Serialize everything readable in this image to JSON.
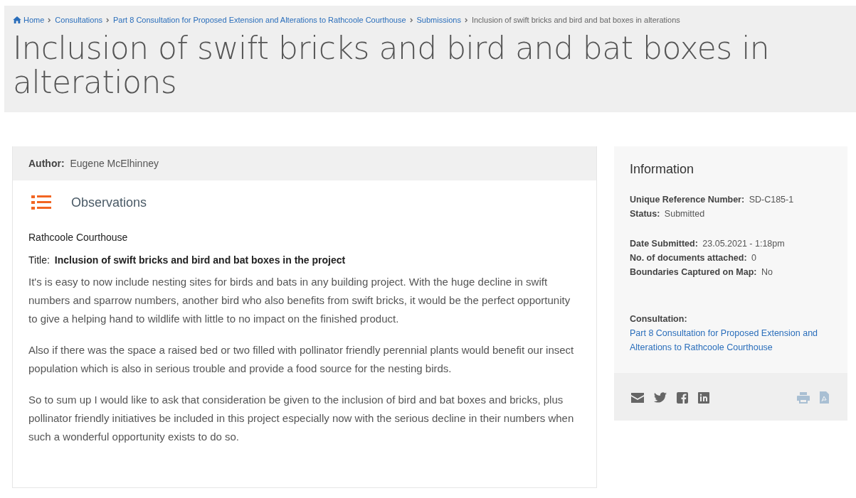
{
  "breadcrumb": [
    {
      "label": "Home",
      "kind": "link"
    },
    {
      "label": "Consultations",
      "kind": "link"
    },
    {
      "label": "Part 8 Consultation for Proposed Extension and Alterations to Rathcoole Courthouse",
      "kind": "link"
    },
    {
      "label": "Submissions",
      "kind": "link"
    },
    {
      "label": "Inclusion of swift bricks and bird and bat boxes in alterations",
      "kind": "current"
    }
  ],
  "page_title": "Inclusion of swift bricks and bird and bat boxes in alterations",
  "submission": {
    "author_label": "Author:",
    "author": "Eugene McElhinney",
    "section_heading": "Observations",
    "location": "Rathcoole Courthouse",
    "title_label": "Title:",
    "title": "Inclusion of swift bricks and bird and bat boxes in the project",
    "paragraphs": [
      "It's is easy to now include nesting sites for birds and bats in any building project. With the huge decline in swift numbers and sparrow numbers, another bird who also benefits from swift bricks, it would be the perfect opportunity to give a helping hand to wildlife with  little to no impact on the finished product.",
      "Also if there was the space a raised bed or two filled with pollinator friendly perennial plants would benefit our insect population which is also in serious trouble and provide a food source for the nesting birds.",
      "So to sum up I would like to ask that consideration be given to the inclusion of bird and bat boxes and bricks, plus pollinator friendly initiatives be included in this project especially now with the serious decline in their numbers when such a wonderful opportunity exists to do so."
    ]
  },
  "information": {
    "heading": "Information",
    "groups": [
      [
        {
          "label": "Unique Reference Number:",
          "value": "SD-C185-1"
        },
        {
          "label": "Status:",
          "value": "Submitted"
        }
      ],
      [
        {
          "label": "Date Submitted:",
          "value": "23.05.2021 - 1:18pm"
        },
        {
          "label": "No. of documents attached:",
          "value": "0"
        },
        {
          "label": "Boundaries Captured on Map:",
          "value": "No"
        }
      ]
    ],
    "consultation_label": "Consultation:",
    "consultation_link": "Part 8 Consultation for Proposed Extension and Alterations to Rathcoole Courthouse",
    "share": [
      {
        "kind": "email"
      },
      {
        "kind": "twitter"
      },
      {
        "kind": "facebook"
      },
      {
        "kind": "linkedin"
      }
    ],
    "tools": [
      {
        "kind": "print"
      },
      {
        "kind": "pdf"
      }
    ]
  }
}
